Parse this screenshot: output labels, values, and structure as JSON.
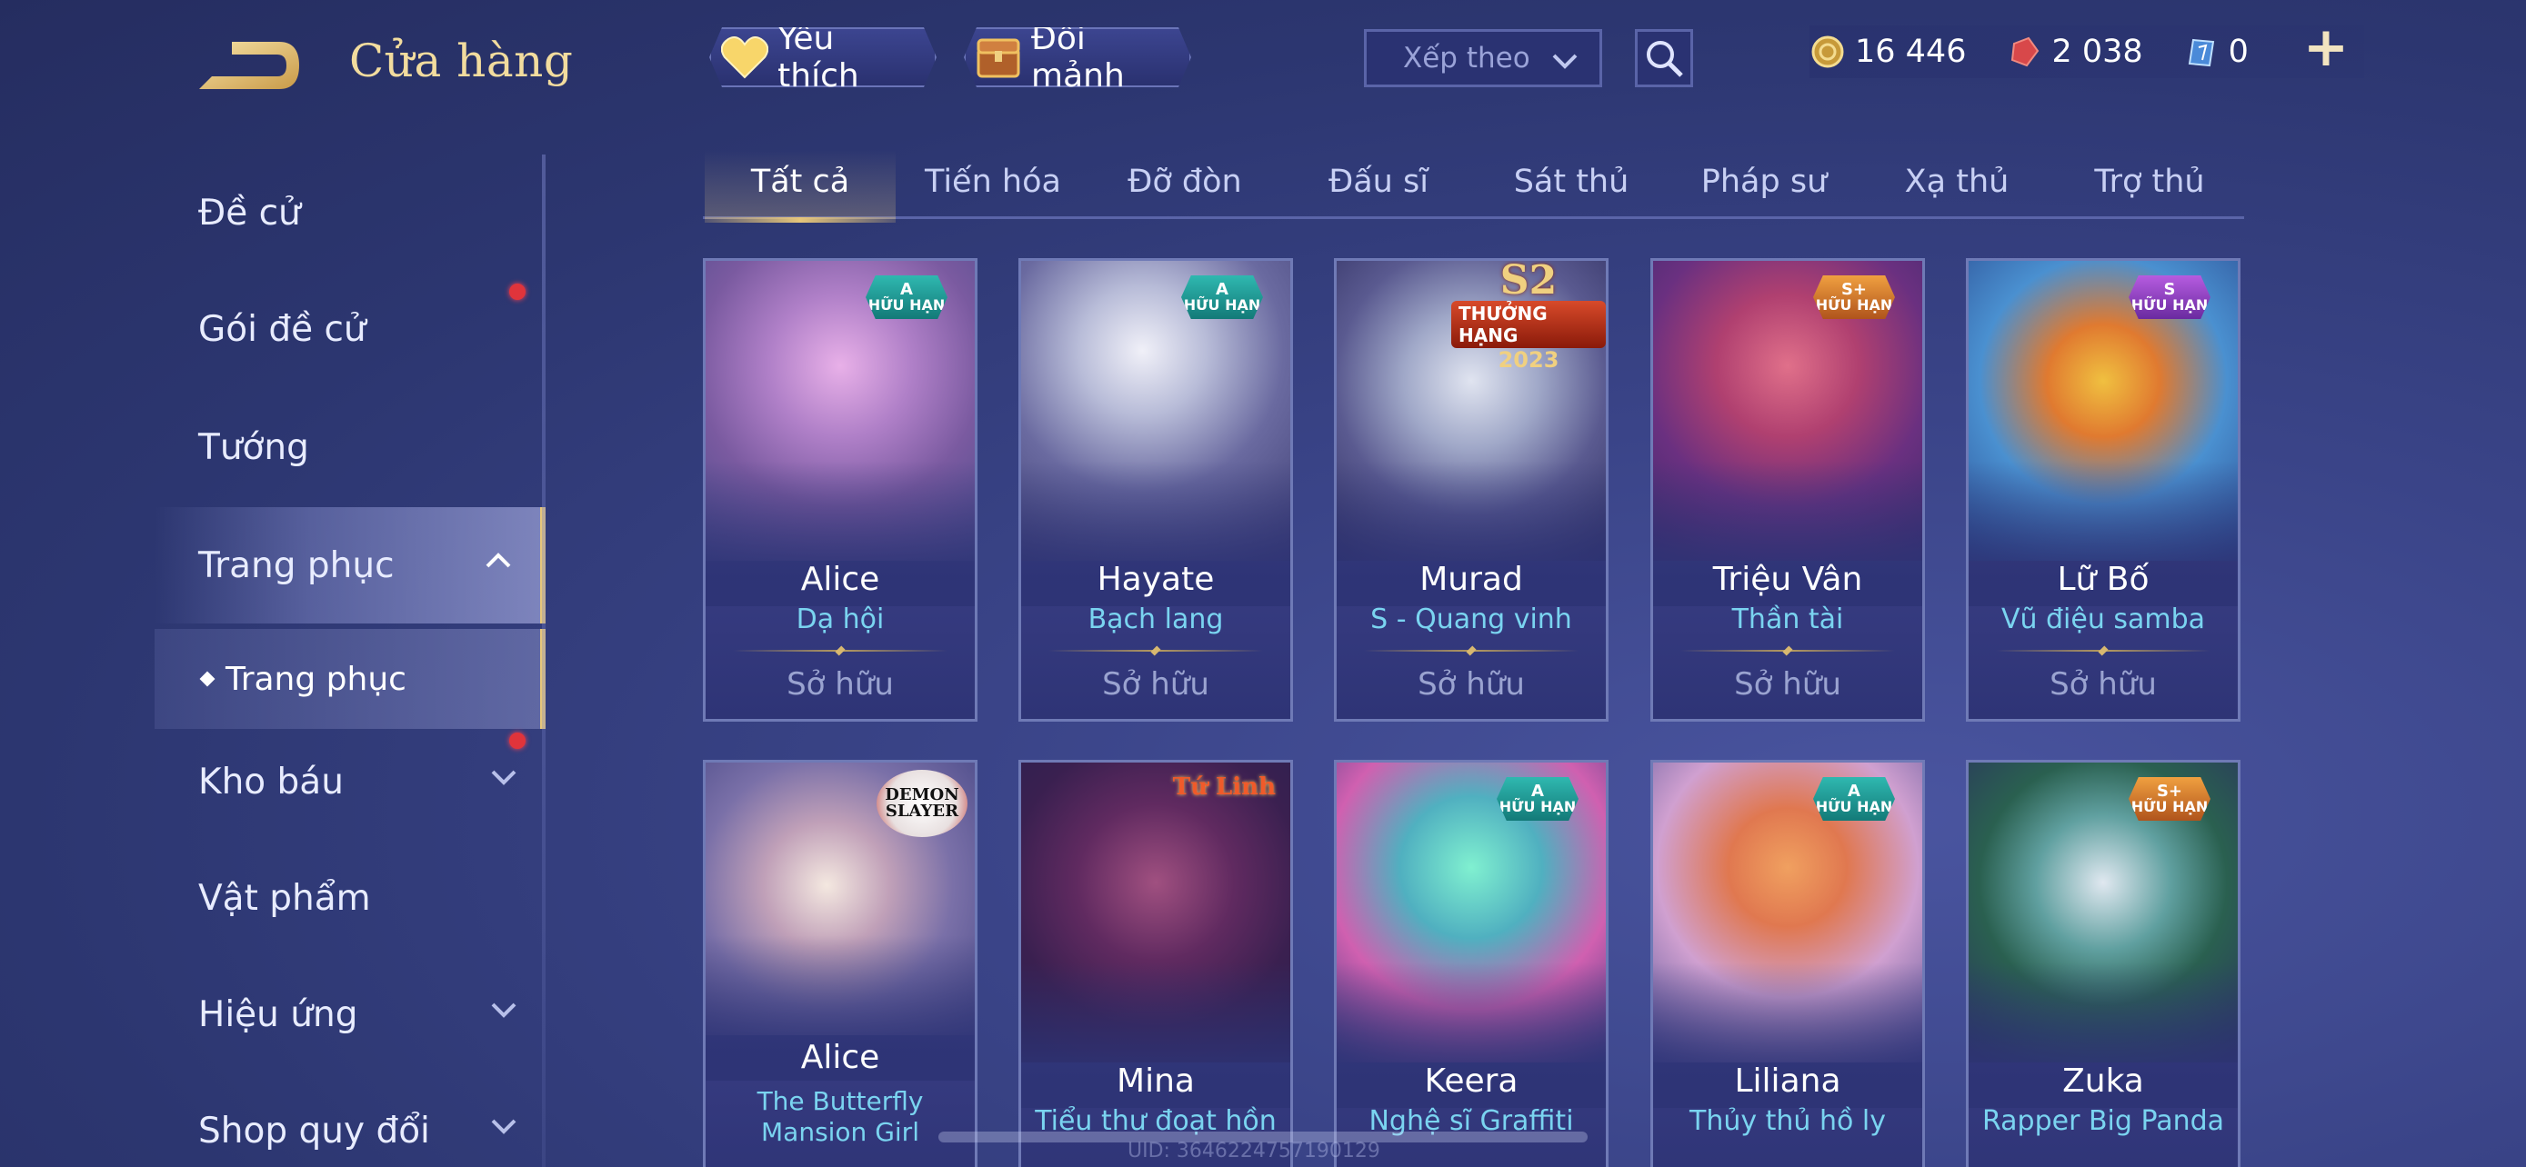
{
  "header": {
    "title": "Cửa hàng",
    "favorite_label": "Yêu thích",
    "fragment_label": "Đổi mảnh",
    "sort_placeholder": "Xếp theo"
  },
  "currency": {
    "gold": "16 446",
    "gems": "2 038",
    "vouchers": "0",
    "colors": {
      "gold": "#e6c67a",
      "gems": "#d8484a",
      "vouchers": "#7ab8f0"
    }
  },
  "sidebar": {
    "items": [
      {
        "label": "Đề cử"
      },
      {
        "label": "Gói đề cử"
      },
      {
        "label": "Tướng"
      },
      {
        "label": "Trang phục"
      },
      {
        "label": "Trang phục"
      },
      {
        "label": "Kho báu"
      },
      {
        "label": "Vật phẩm"
      },
      {
        "label": "Hiệu ứng"
      },
      {
        "label": "Shop quy đổi"
      }
    ]
  },
  "tabs": [
    "Tất cả",
    "Tiến hóa",
    "Đỡ đòn",
    "Đấu sĩ",
    "Sát thủ",
    "Pháp sư",
    "Xạ thủ",
    "Trợ thủ"
  ],
  "cards": [
    {
      "hero": "Alice",
      "skin": "Dạ hội",
      "status": "Sở hữu",
      "badge": {
        "grade": "A",
        "text": "HỮU HẠN",
        "color": "teal"
      }
    },
    {
      "hero": "Hayate",
      "skin": "Bạch lang",
      "status": "Sở hữu",
      "badge": {
        "grade": "A",
        "text": "HỮU HẠN",
        "color": "teal"
      }
    },
    {
      "hero": "Murad",
      "skin": "S - Quang vinh",
      "status": "Sở hữu",
      "badge": {
        "grade": "S2",
        "text": "THƯỞNG HẠNG",
        "year": "2023"
      }
    },
    {
      "hero": "Triệu Vân",
      "skin": "Thần tài",
      "status": "Sở hữu",
      "badge": {
        "grade": "S+",
        "text": "HỮU HẠN",
        "color": "orange"
      }
    },
    {
      "hero": "Lữ Bố",
      "skin": "Vũ điệu samba",
      "status": "Sở hữu",
      "badge": {
        "grade": "S",
        "text": "HỮU HẠN",
        "color": "purple"
      }
    },
    {
      "hero": "Alice",
      "skin": "The Butterfly Mansion Girl",
      "status": "",
      "badge": {
        "text": "DEMON SLAYER"
      }
    },
    {
      "hero": "Mina",
      "skin": "Tiểu thư đoạt hồn",
      "status": "",
      "badge": {
        "text": "Tứ Linh"
      }
    },
    {
      "hero": "Keera",
      "skin": "Nghệ sĩ Graffiti",
      "status": "",
      "badge": {
        "grade": "A",
        "text": "HỮU HẠN",
        "color": "teal"
      }
    },
    {
      "hero": "Liliana",
      "skin": "Thủy thủ hồ ly",
      "status": "",
      "badge": {
        "grade": "A",
        "text": "HỮU HẠN",
        "color": "teal"
      }
    },
    {
      "hero": "Zuka",
      "skin": "Rapper Big Panda",
      "status": "",
      "badge": {
        "grade": "S+",
        "text": "HỮU HẠN",
        "color": "orange"
      }
    }
  ],
  "footer": {
    "uid": "UID: 3646224757190129"
  }
}
